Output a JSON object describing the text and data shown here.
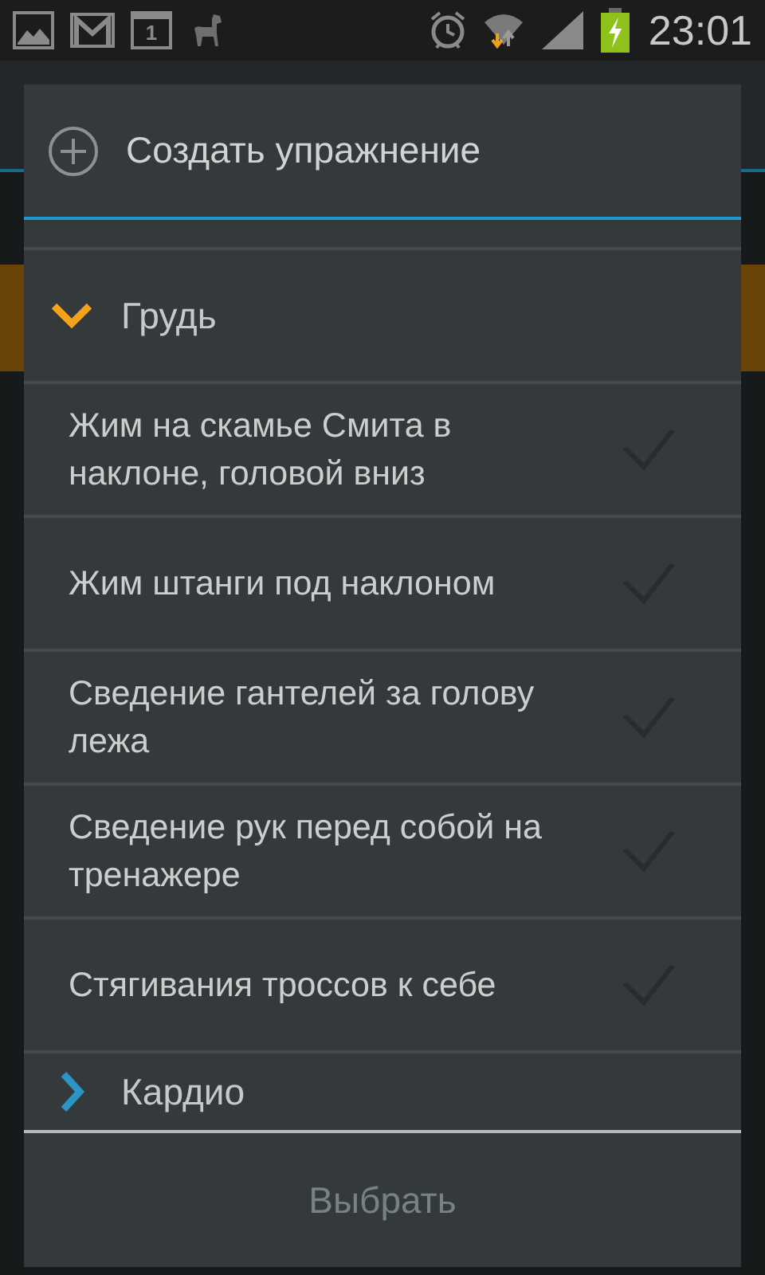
{
  "status_bar": {
    "calendar_day": "1",
    "time": "23:01"
  },
  "dialog": {
    "create_label": "Создать упражнение",
    "groups": [
      {
        "name": "Грудь",
        "expanded": true,
        "children": [
          {
            "name": "Жим на скамье Смита в наклоне, головой вниз",
            "checked": false
          },
          {
            "name": "Жим штанги под наклоном",
            "checked": false
          },
          {
            "name": "Сведение гантелей за голову лежа",
            "checked": false
          },
          {
            "name": "Сведение рук перед собой на тренажере",
            "checked": false
          },
          {
            "name": "Стягивания троссов к себе",
            "checked": false
          }
        ]
      },
      {
        "name": "Кардио",
        "expanded": false
      }
    ],
    "button": {
      "label": "Выбрать",
      "disabled": true
    }
  }
}
